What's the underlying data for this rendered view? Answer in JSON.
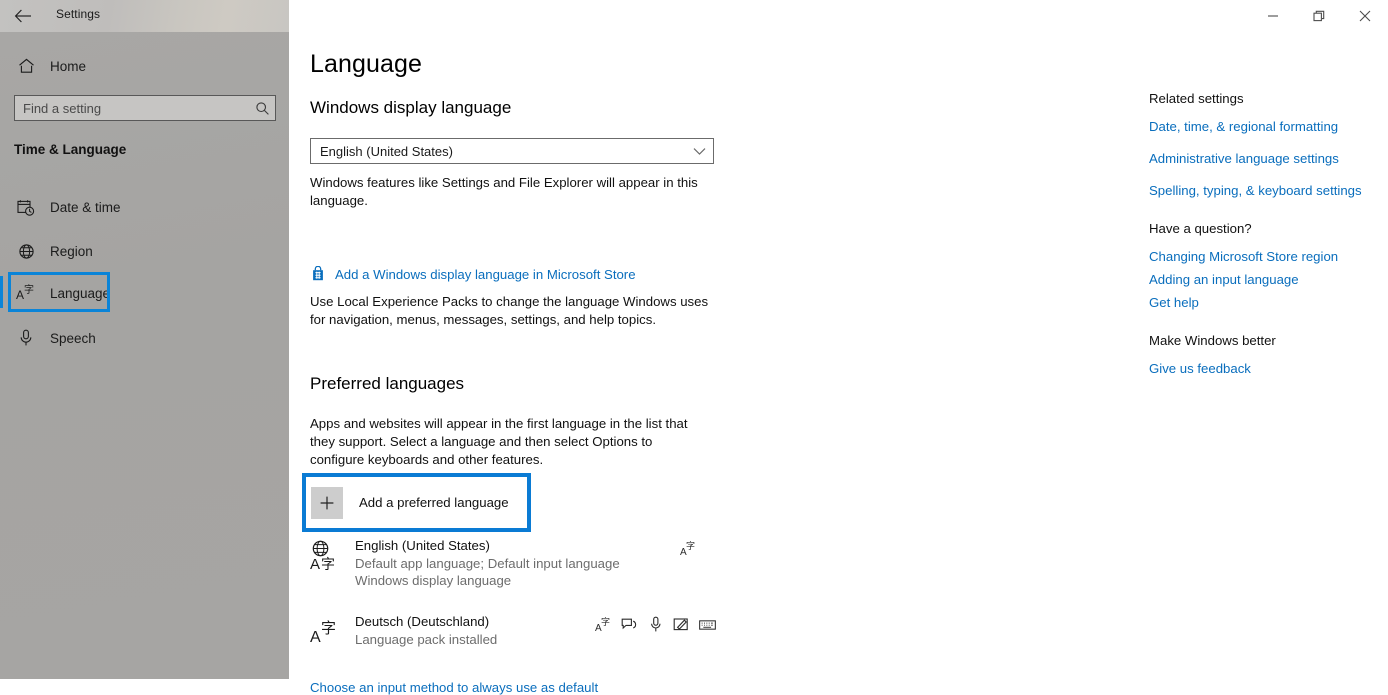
{
  "titlebar": {
    "app_name": "Settings",
    "back_icon": "back-arrow-icon",
    "minimize_label": "–",
    "restore_label": "❐",
    "close_label": "✕"
  },
  "sidebar": {
    "home_label": "Home",
    "search": {
      "placeholder": "Find a setting",
      "value": "",
      "icon": "search-icon"
    },
    "group_header": "Time & Language",
    "items": [
      {
        "label": "Date & time",
        "icon": "calendar-clock-icon",
        "selected": false
      },
      {
        "label": "Region",
        "icon": "globe-icon",
        "selected": false
      },
      {
        "label": "Language",
        "icon": "language-a-icon",
        "selected": true
      },
      {
        "label": "Speech",
        "icon": "microphone-icon",
        "selected": false
      }
    ]
  },
  "main": {
    "page_title": "Language",
    "display_language": {
      "heading": "Windows display language",
      "selected": "English (United States)",
      "chevron_icon": "chevron-down-icon",
      "description": "Windows features like Settings and File Explorer will appear in this language.",
      "store_link": "Add a Windows display language in Microsoft Store",
      "store_icon": "microsoft-store-icon",
      "lep_description": "Use Local Experience Packs to change the language Windows uses for navigation, menus, messages, settings, and help topics."
    },
    "preferred_languages": {
      "heading": "Preferred languages",
      "description": "Apps and websites will appear in the first language in the list that they support. Select a language and then select Options to configure keyboards and other features.",
      "add_button_label": "Add a preferred language",
      "add_button_icon": "plus-icon",
      "languages": [
        {
          "name": "English (United States)",
          "meta_line_1": "Default app language; Default input language",
          "meta_line_2": "Windows display language",
          "icon": "globe-language-pack-icon",
          "actions": [
            "language-pack-icon"
          ]
        },
        {
          "name": "Deutsch (Deutschland)",
          "meta_line_1": "Language pack installed",
          "meta_line_2": "",
          "icon": "language-pack-icon",
          "actions": [
            "language-pack-icon",
            "speech-recognition-icon",
            "microphone-icon",
            "handwriting-pen-icon",
            "keyboard-icon"
          ]
        }
      ],
      "bottom_link": "Choose an input method to always use as default"
    }
  },
  "right_panel": {
    "related_settings": {
      "heading": "Related settings",
      "links": [
        "Date, time, & regional formatting",
        "Administrative language settings",
        "Spelling, typing, & keyboard settings"
      ]
    },
    "have_a_question": {
      "heading": "Have a question?",
      "links": [
        "Changing Microsoft Store region",
        "Adding an input language",
        "Get help"
      ]
    },
    "make_windows_better": {
      "heading": "Make Windows better",
      "links": [
        "Give us feedback"
      ]
    }
  },
  "colors": {
    "accent_blue": "#0a7bd4",
    "link_blue": "#0a6ebd",
    "sidebar_bg": "#a6a5a3",
    "store_blue": "#0a6ebd"
  }
}
